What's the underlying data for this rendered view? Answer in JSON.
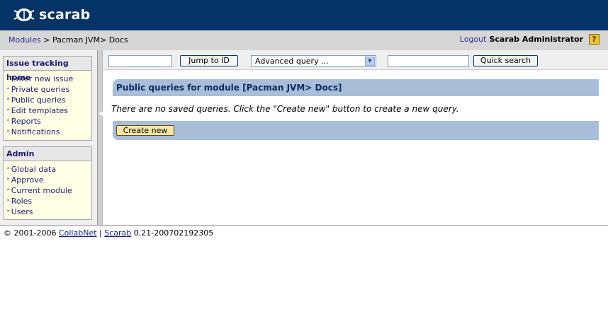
{
  "app": {
    "logo_text": "scarab",
    "brand_color": "#043367"
  },
  "breadcrumb": {
    "modules": "Modules",
    "separator": ">",
    "path": "Pacman JVM> Docs"
  },
  "user": {
    "logout": "Logout",
    "name": "Scarab Administrator",
    "help_icon": "help-icon"
  },
  "sidebar": {
    "issue_title": "Issue tracking home",
    "issue_items": [
      "Enter new issue",
      "Private queries",
      "Public queries",
      "Edit templates",
      "Reports",
      "Notifications"
    ],
    "admin_title": "Admin",
    "admin_items": [
      "Global data",
      "Approve",
      "Current module",
      "Roles",
      "Users"
    ]
  },
  "toolbar": {
    "id_value": "",
    "jump_label": "Jump to ID",
    "query_selected": "Advanced query ...",
    "search_value": "",
    "quick_search_label": "Quick search"
  },
  "main": {
    "title": "Public queries for module [Pacman JVM> Docs]",
    "empty_message": "There are no saved queries. Click the \"Create new\" button to create a new query.",
    "create_label": "Create new"
  },
  "footer": {
    "copyright": "© 2001-2006",
    "collabnet": "CollabNet",
    "separator": "|",
    "scarab": "Scarab",
    "version": "0.21-200702192305"
  }
}
